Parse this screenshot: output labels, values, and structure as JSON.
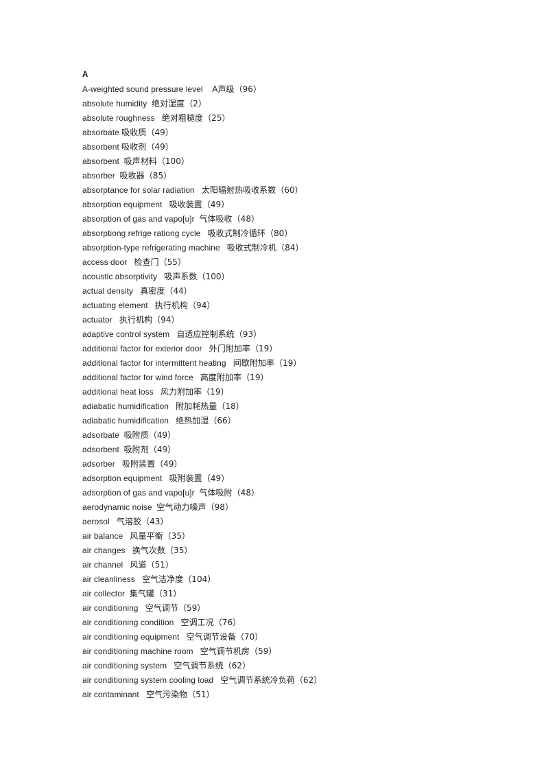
{
  "document": {
    "type": "bilingual-glossary-index",
    "background_color": "#ffffff",
    "text_color": "#222222",
    "section_letter": "A"
  },
  "entries": [
    {
      "term": "A-weighted sound pressure level",
      "gap": "    ",
      "translation": "A声级",
      "page_ref": "（96）"
    },
    {
      "term": "absolute humidity",
      "gap": "  ",
      "translation": "绝对湿度",
      "page_ref": "（2）"
    },
    {
      "term": "absolute roughness",
      "gap": "   ",
      "translation": "绝对粗糙度",
      "page_ref": "（25）"
    },
    {
      "term": "absorbate",
      "gap": " ",
      "translation": "吸收质",
      "page_ref": "（49）"
    },
    {
      "term": "absorbent",
      "gap": " ",
      "translation": "吸收剂",
      "page_ref": "（49）"
    },
    {
      "term": "absorbent",
      "gap": "  ",
      "translation": "吸声材料",
      "page_ref": "（100）"
    },
    {
      "term": "absorber",
      "gap": "  ",
      "translation": "吸收器",
      "page_ref": "（85）"
    },
    {
      "term": "absorptance for solar radiation",
      "gap": "   ",
      "translation": "太阳辐射热吸收系数",
      "page_ref": "（60）"
    },
    {
      "term": "absorption equipment",
      "gap": "   ",
      "translation": "吸收装置",
      "page_ref": "（49）"
    },
    {
      "term": "absorption of gas and vapo[u]r",
      "gap": "  ",
      "translation": "气体吸收",
      "page_ref": "（48）"
    },
    {
      "term": "absorptiong refrige rationg cycle",
      "gap": "   ",
      "translation": "吸收式制冷循环",
      "page_ref": "（80）"
    },
    {
      "term": "absorption-type refrigerating machine",
      "gap": "   ",
      "translation": "吸收式制冷机",
      "page_ref": "（84）"
    },
    {
      "term": "access door",
      "gap": "   ",
      "translation": "检查门",
      "page_ref": "（55）"
    },
    {
      "term": "acoustic absorptivity",
      "gap": "   ",
      "translation": "吸声系数",
      "page_ref": "（100）"
    },
    {
      "term": "actual density",
      "gap": "   ",
      "translation": "真密度",
      "page_ref": "（44）"
    },
    {
      "term": "actuating element",
      "gap": "   ",
      "translation": "执行机构",
      "page_ref": "（94）"
    },
    {
      "term": "actuator",
      "gap": "   ",
      "translation": "执行机构",
      "page_ref": "（94）"
    },
    {
      "term": "adaptive control system",
      "gap": "   ",
      "translation": "自适应控制系统",
      "page_ref": "（93）"
    },
    {
      "term": "additional factor for exterior door",
      "gap": "   ",
      "translation": "外门附加率",
      "page_ref": "（19）"
    },
    {
      "term": "additional factor for intermittent heating",
      "gap": "   ",
      "translation": "间歇附加率",
      "page_ref": "（19）"
    },
    {
      "term": "additional factor for wind force",
      "gap": "   ",
      "translation": "高度附加率",
      "page_ref": "（19）"
    },
    {
      "term": "additional heat loss",
      "gap": "   ",
      "translation": "风力附加率",
      "page_ref": "（19）"
    },
    {
      "term": "adiabatic humidification",
      "gap": "   ",
      "translation": "附加耗热量",
      "page_ref": "（18）"
    },
    {
      "term": "adiabatic humidiflcation",
      "gap": "   ",
      "translation": "绝热加湿",
      "page_ref": "（66）"
    },
    {
      "term": "adsorbate",
      "gap": "  ",
      "translation": "吸附质",
      "page_ref": "（49）"
    },
    {
      "term": "adsorbent",
      "gap": "  ",
      "translation": "吸附剂",
      "page_ref": "（49）"
    },
    {
      "term": "adsorber",
      "gap": "   ",
      "translation": "吸附装置",
      "page_ref": "（49）"
    },
    {
      "term": "adsorption equipment",
      "gap": "   ",
      "translation": "吸附装置",
      "page_ref": "（49）"
    },
    {
      "term": "adsorption of gas and vapo[u]r",
      "gap": "  ",
      "translation": "气体吸附",
      "page_ref": "（48）"
    },
    {
      "term": "aerodynamic noise",
      "gap": "  ",
      "translation": "空气动力噪声",
      "page_ref": "（98）"
    },
    {
      "term": "aerosol",
      "gap": "   ",
      "translation": "气溶胶",
      "page_ref": "（43）"
    },
    {
      "term": "air balance",
      "gap": "   ",
      "translation": "风量平衡",
      "page_ref": "（35）"
    },
    {
      "term": "air changes",
      "gap": "   ",
      "translation": "换气次数",
      "page_ref": "（35）"
    },
    {
      "term": "air channel",
      "gap": "   ",
      "translation": "风道",
      "page_ref": "（51）"
    },
    {
      "term": "air cleanliness",
      "gap": "   ",
      "translation": "空气洁净度",
      "page_ref": "（104）"
    },
    {
      "term": "air collector",
      "gap": "  ",
      "translation": "集气罐",
      "page_ref": "（31）"
    },
    {
      "term": "air conditioning",
      "gap": "   ",
      "translation": "空气调节",
      "page_ref": "（59）"
    },
    {
      "term": "air conditioning condition",
      "gap": "   ",
      "translation": "空调工况",
      "page_ref": "（76）"
    },
    {
      "term": "air conditioning equipment",
      "gap": "   ",
      "translation": "空气调节设备",
      "page_ref": "（70）"
    },
    {
      "term": "air conditioning machine room",
      "gap": "   ",
      "translation": "空气调节机房",
      "page_ref": "（59）"
    },
    {
      "term": "air conditioning system",
      "gap": "   ",
      "translation": "空气调节系统",
      "page_ref": "（62）"
    },
    {
      "term": "air conditioning system cooling load",
      "gap": "   ",
      "translation": "空气调节系统冷负荷",
      "page_ref": "（62）"
    },
    {
      "term": "air contaminant",
      "gap": "   ",
      "translation": "空气污染物",
      "page_ref": "（51）"
    }
  ]
}
